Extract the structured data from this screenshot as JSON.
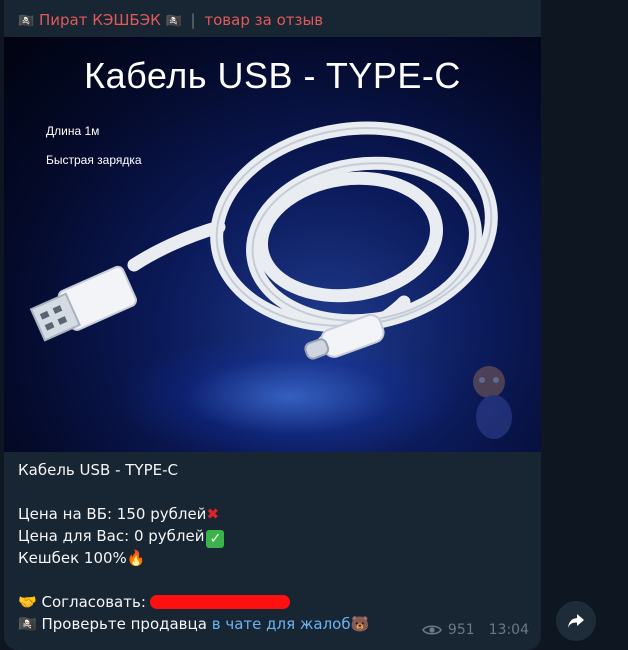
{
  "post": {
    "channel_name": "Пират КЭШБЭК",
    "header_suffix": "товар за отзыв",
    "photo": {
      "title": "Кабель USB - TYPE-C",
      "spec1": "Длина 1м",
      "spec2": "Быстрая зарядка"
    },
    "caption": {
      "title": "Кабель USB - TYPE-C",
      "price_wb": "Цена на ВБ: 150 рублей",
      "price_you": "Цена для Вас: 0 рублей",
      "cashback": "Кешбек 100%",
      "agree_label": "Согласовать:",
      "check_seller": "Проверьте продавца",
      "complaints_link": "в чате для жалоб"
    },
    "views": "951",
    "time": "13:04"
  },
  "colors": {
    "background": "#0e1621",
    "bubble": "#182533",
    "accent_header": "#e05a5a",
    "link": "#6ab3f3",
    "meta": "#6c7883"
  },
  "icons": {
    "header_left": "pirate-flag-icon",
    "header_right": "pirate-flag-icon",
    "views": "eye-icon",
    "share": "share-arrow-icon"
  }
}
